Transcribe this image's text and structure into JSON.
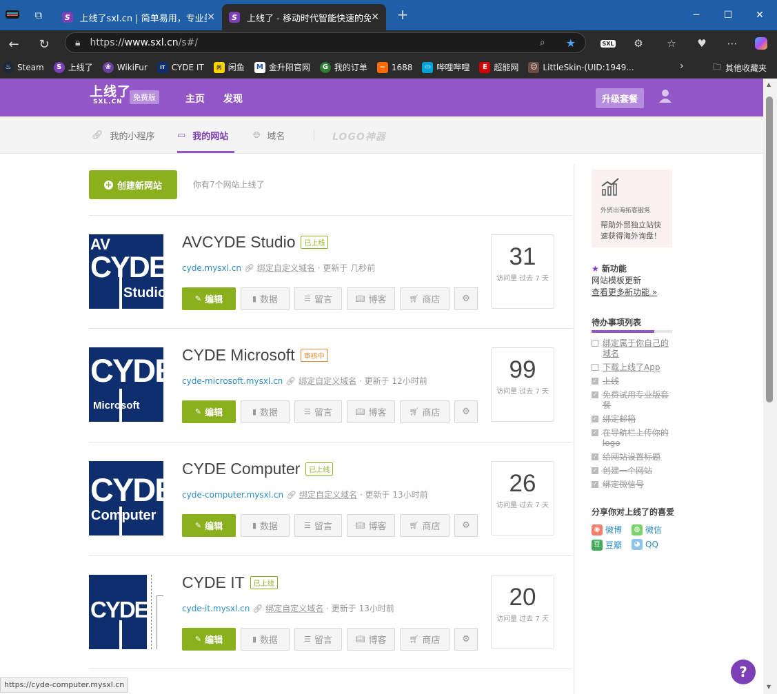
{
  "browser": {
    "tabs": [
      {
        "title": "上线了sxl.cn | 简单易用，专业美观"
      },
      {
        "title": "上线了 - 移动时代智能快速的免费"
      }
    ],
    "url_host": "www.sxl.cn",
    "url_path": "/s#/",
    "url_scheme": "https://",
    "bookmarks": [
      {
        "label": "Steam",
        "color": "#1b2838"
      },
      {
        "label": "上线了",
        "color": "#7c3fb5"
      },
      {
        "label": "WikiFur",
        "color": "#6b3fa0"
      },
      {
        "label": "CYDE IT",
        "color": "#0f2e6e"
      },
      {
        "label": "闲鱼",
        "color": "#ffd400"
      },
      {
        "label": "金升阳官网",
        "color": "#1a56a6"
      },
      {
        "label": "我的订单",
        "color": "#2e7d32"
      },
      {
        "label": "1688",
        "color": "#ff6a00"
      },
      {
        "label": "哔哩哔哩",
        "color": "#00a1d6"
      },
      {
        "label": "超能网",
        "color": "#d10000"
      },
      {
        "label": "LittleSkin-(UID:1949...",
        "color": "#6d4c41"
      }
    ],
    "other_bookmarks": "其他收藏夹",
    "status_url": "https://cyde-computer.mysxl.cn"
  },
  "header": {
    "logo_main": "上线了",
    "logo_sub": "SXL.CN",
    "free_badge": "免费版",
    "nav_home": "主页",
    "nav_discover": "发现",
    "upgrade": "升级套餐"
  },
  "subnav": {
    "mini_program": "我的小程序",
    "my_sites": "我的网站",
    "domain": "域名",
    "logo_god": "LOGO神器"
  },
  "main": {
    "create_label": "创建新网站",
    "count_text": "你有7个网站上线了",
    "bind_label": "绑定自定义域名",
    "visits_label": "访问量 过去 7 天",
    "buttons": {
      "edit": "编辑",
      "data": "数据",
      "comments": "留言",
      "blog": "博客",
      "shop": "商店"
    },
    "sites": [
      {
        "name": "AVCYDE Studio",
        "status": "已上线",
        "domain": "cyde.mysxl.cn",
        "updated": "更新于 几秒前",
        "visits": "31"
      },
      {
        "name": "CYDE Microsoft",
        "status": "审核中",
        "domain": "cyde-microsoft.mysxl.cn",
        "updated": "更新于 12小时前",
        "visits": "99"
      },
      {
        "name": "CYDE Computer",
        "status": "已上线",
        "domain": "cyde-computer.mysxl.cn",
        "updated": "更新于 13小时前",
        "visits": "26"
      },
      {
        "name": "CYDE IT",
        "status": "已上线",
        "domain": "cyde-it.mysxl.cn",
        "updated": "更新于 13小时前",
        "visits": "20"
      }
    ],
    "thumbs": [
      {
        "top": "AV",
        "big": "CYDE",
        "bottom": "Studio"
      },
      {
        "big": "CYDE",
        "bottom": "Microsoft"
      },
      {
        "big": "CYDE",
        "bottom": "Computer"
      },
      {
        "big": "CYDE"
      }
    ]
  },
  "sidebar": {
    "promo_title": "外贸出海拓客服务",
    "promo_text": "帮助外贸独立站快速获得海外询盘！",
    "new_feature_title": "新功能",
    "new_feature_text": "网站模板更新",
    "new_feature_more": "查看更多新功能 »",
    "todo_title": "待办事项列表",
    "todo_progress": 0.78,
    "todo_items": [
      {
        "text": "绑定属于你自己的域名",
        "done": false
      },
      {
        "text": "下载上线了App",
        "done": false
      },
      {
        "text": "上线",
        "done": true
      },
      {
        "text": "免费试用专业版套餐",
        "done": true
      },
      {
        "text": "绑定邮箱",
        "done": true
      },
      {
        "text": "在导航栏上传你的logo",
        "done": true
      },
      {
        "text": "给网站设置标题",
        "done": true
      },
      {
        "text": "创建一个网站",
        "done": true
      },
      {
        "text": "绑定微信号",
        "done": true
      }
    ],
    "share_title": "分享你对上线了的喜爱",
    "share": {
      "weibo": "微博",
      "wechat": "微信",
      "douban": "豆瓣",
      "qq": "QQ"
    }
  },
  "colors": {
    "brand": "#9356c6",
    "green": "#8ab01e",
    "link": "#2d8ec4"
  }
}
